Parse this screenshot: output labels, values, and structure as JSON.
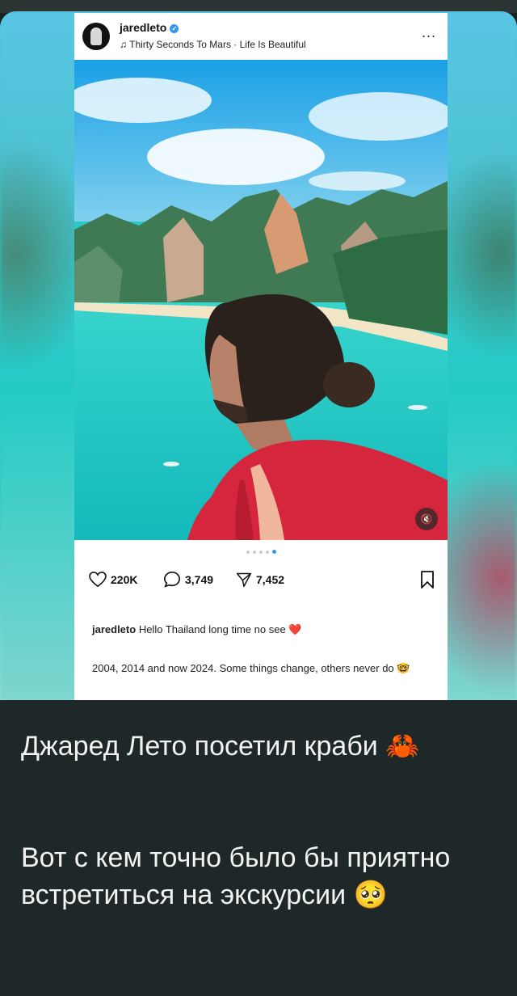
{
  "post": {
    "username": "jaredleto",
    "verified_mark": "✓",
    "song": "♫ Thirty Seconds To Mars · Life Is Beautiful",
    "menu": "...",
    "mute_icon": "🔇",
    "likes": "220K",
    "comments": "3,749",
    "shares": "7,452",
    "caption_user": "jaredleto",
    "caption_text": "Hello Thailand long time no see ❤️",
    "caption_line2": "2004, 2014 and now 2024. Some things change, others never do 🤓"
  },
  "message": {
    "line1": "Джаред Лето посетил краби 🦀",
    "line2": "Вот с кем точно было бы приятно встретиться на экскурсии 🥺"
  },
  "colors": {
    "chat_bg": "#1b2222",
    "verified": "#3797f0",
    "text_light": "#f3f3f3"
  },
  "icons": [
    "avatar",
    "verified-icon",
    "more-icon",
    "mute-icon",
    "heart-icon",
    "comment-icon",
    "share-icon",
    "bookmark-icon"
  ]
}
